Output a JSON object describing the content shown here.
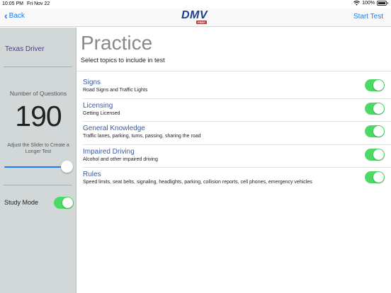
{
  "status": {
    "time": "10:05 PM",
    "date": "Fri Nov 22",
    "battery": "100%"
  },
  "nav": {
    "back_label": "Back",
    "logo_text": "DMV",
    "logo_badge": "PREP",
    "start_label": "Start Test"
  },
  "sidebar": {
    "driver": "Texas Driver",
    "questions_label": "Number of Questions",
    "questions_value": "190",
    "slider_hint": "Adjust the Slider to Create a Longer Test",
    "slider_level": 1.0,
    "study_mode_label": "Study Mode",
    "study_mode_on": true
  },
  "main": {
    "title": "Practice",
    "subtitle": "Select topics to include in test",
    "topics": [
      {
        "title": "Signs",
        "desc": "Road Signs and Traffic Lights",
        "on": true
      },
      {
        "title": "Licensing",
        "desc": "Getting Licensed",
        "on": true
      },
      {
        "title": "General Knowledge",
        "desc": "Traffic lanes, parking, turns, passing, sharing the road",
        "on": true
      },
      {
        "title": "Impaired Driving",
        "desc": "Alcohol and other impaired driving",
        "on": true
      },
      {
        "title": "Rules",
        "desc": "Speed limits, seat belts, signaling, headlights, parking, collision reports, cell phones, emergency vehicles",
        "on": true
      }
    ]
  },
  "colors": {
    "accent": "#1a7cf5",
    "toggle_on": "#4cd964",
    "sidebar_bg": "#d2d8d8",
    "topic_title": "#3c5a9a"
  }
}
